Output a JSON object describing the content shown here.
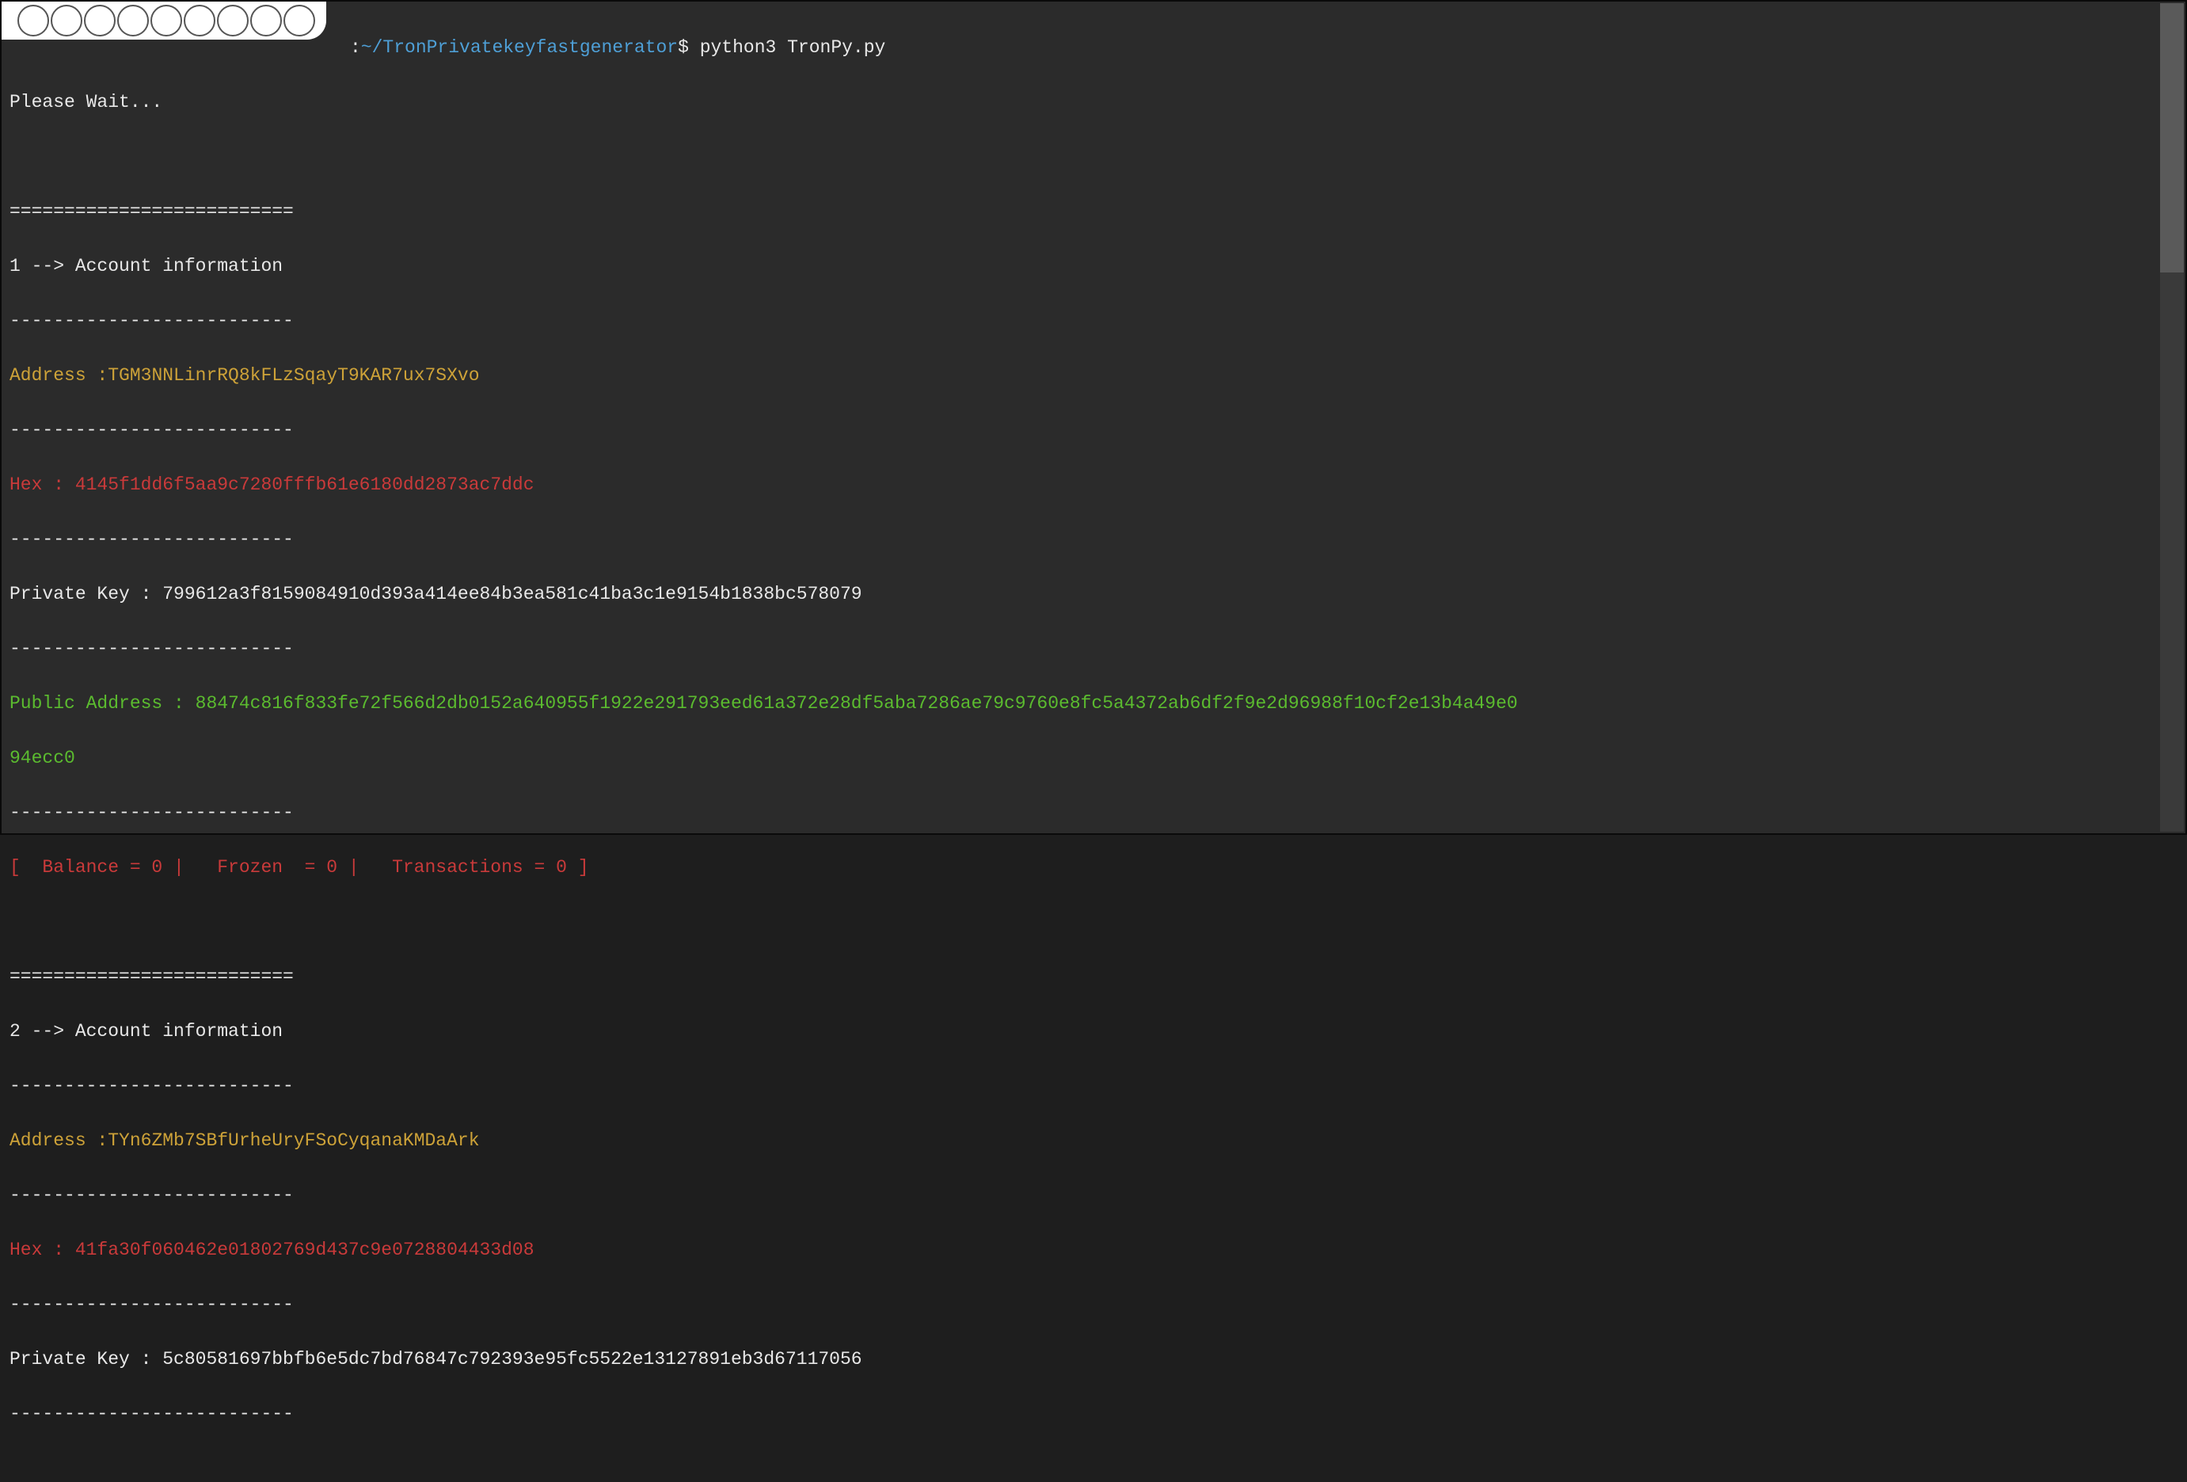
{
  "prompt": {
    "colon": ":",
    "path": "~/TronPrivatekeyfastgenerator",
    "dollar": "$",
    "command": " python3 TronPy.py"
  },
  "wait_line": "Please Wait...",
  "blank": "",
  "sep_equal": "==========================",
  "sep_dash": "--------------------------",
  "accounts": [
    {
      "header": "1 --> Account information",
      "address_label": "Address :",
      "address_value": "TGM3NNLinrRQ8kFLzSqayT9KAR7ux7SXvo",
      "hex_label": "Hex : ",
      "hex_value": "4145f1dd6f5aa9c7280fffb61e6180dd2873ac7ddc",
      "private_label": "Private Key : ",
      "private_value": "799612a3f8159084910d393a414ee84b3ea581c41ba3c1e9154b1838bc578079",
      "public_label": "Public Address : ",
      "public_value_1": "88474c816f833fe72f566d2db0152a640955f1922e291793eed61a372e28df5aba7286ae79c9760e8fc5a4372ab6df2f9e2d96988f10cf2e13b4a49e0",
      "public_value_2": "94ecc0",
      "stats": "[  Balance = 0 |   Frozen  = 0 |   Transactions = 0 ]"
    },
    {
      "header": "2 --> Account information",
      "address_label": "Address :",
      "address_value": "TYn6ZMb7SBfUrheUryFSoCyqanaKMDaArk",
      "hex_label": "Hex : ",
      "hex_value": "41fa30f060462e01802769d437c9e0728804433d08",
      "private_label": "Private Key : ",
      "private_value": "5c80581697bbfb6e5dc7bd76847c792393e95fc5522e13127891eb3d67117056"
    }
  ]
}
